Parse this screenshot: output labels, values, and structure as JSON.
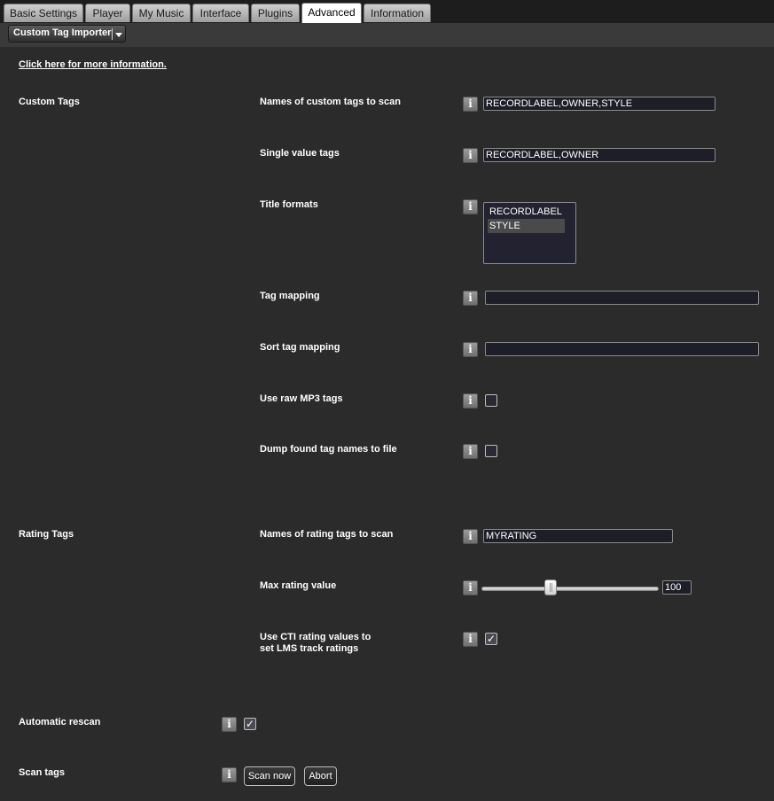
{
  "tabs": [
    {
      "label": "Basic Settings",
      "active": false
    },
    {
      "label": "Player",
      "active": false
    },
    {
      "label": "My Music",
      "active": false
    },
    {
      "label": "Interface",
      "active": false
    },
    {
      "label": "Plugins",
      "active": false
    },
    {
      "label": "Advanced",
      "active": true
    },
    {
      "label": "Information",
      "active": false
    }
  ],
  "plugin_selector": {
    "value": "Custom Tag Importer"
  },
  "info_link": "Click here for more information.",
  "custom_tags": {
    "section_label": "Custom Tags",
    "names_label": "Names of custom tags to scan",
    "names_value": "RECORDLABEL,OWNER,STYLE",
    "single_label": "Single value tags",
    "single_value": "RECORDLABEL,OWNER",
    "title_formats_label": "Title formats",
    "title_formats_options": [
      {
        "label": "RECORDLABEL",
        "selected": false
      },
      {
        "label": "STYLE",
        "selected": true
      }
    ],
    "tag_mapping_label": "Tag mapping",
    "tag_mapping_value": "",
    "sort_mapping_label": "Sort tag mapping",
    "sort_mapping_value": "",
    "raw_mp3_label": "Use raw MP3 tags",
    "raw_mp3_checked": false,
    "dump_label": "Dump found tag names to file",
    "dump_checked": false
  },
  "rating_tags": {
    "section_label": "Rating Tags",
    "names_label": "Names of rating tags to scan",
    "names_value": "MYRATING",
    "max_label": "Max rating value",
    "max_value": "100",
    "slider_fraction": 0.39,
    "cti_label_line1": "Use CTI rating values to",
    "cti_label_line2": "set LMS track ratings",
    "cti_checked": true
  },
  "automatic_rescan": {
    "label": "Automatic rescan",
    "checked": true
  },
  "scan_tags": {
    "label": "Scan tags",
    "scan_now": "Scan now",
    "abort": "Abort"
  },
  "icons": {
    "info": "info-icon",
    "check": "checkmark-icon",
    "dropdown": "chevron-down-icon"
  },
  "colors": {
    "background": "#2b2b2b",
    "tab_active": "#ffffff",
    "tab_inactive": "#b5b5b5"
  }
}
